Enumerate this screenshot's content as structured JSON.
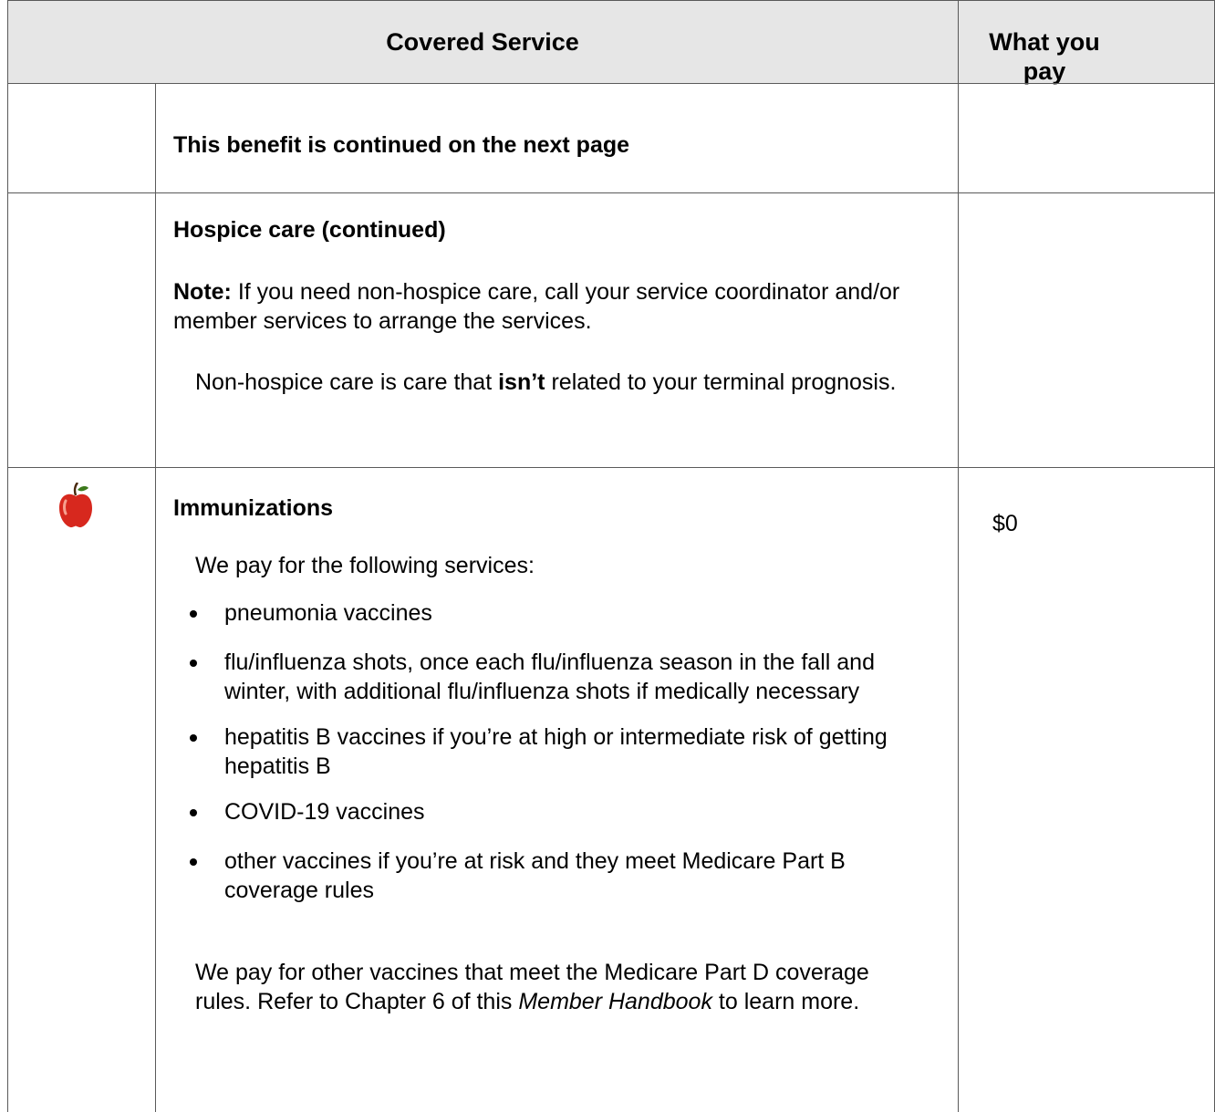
{
  "header": {
    "covered_service": "Covered Service",
    "what_you_pay": "What you pay"
  },
  "row_continued": {
    "text": "This benefit is continued on the next page"
  },
  "row_hospice": {
    "title": "Hospice care (continued)",
    "note_label": "Note:",
    "note_text": " If you need non-hospice care, call your service coordinator and/or member services to arrange the services.",
    "para_before": "Non-hospice care is care that ",
    "para_bold": "isn’t",
    "para_after": " related to your terminal prognosis."
  },
  "row_immunizations": {
    "icon": "apple-icon",
    "icon_color": "#d7281e",
    "title": "Immunizations",
    "pay": "$0",
    "intro": "We pay for the following services:",
    "bullets": [
      "pneumonia vaccines",
      "flu/influenza shots, once each flu/influenza season in the fall and winter, with additional flu/influenza shots if medically necessary",
      "hepatitis B vaccines if you’re at high or intermediate risk of getting hepatitis B",
      "COVID-19 vaccines",
      "other vaccines if you’re at risk and they meet Medicare Part B coverage rules"
    ],
    "closing_before": "We pay for other vaccines that meet the Medicare Part D coverage rules. Refer to Chapter 6 of this ",
    "closing_italic": "Member Handbook",
    "closing_after": " to learn more."
  },
  "colors": {
    "header_bg": "#e6e6e6",
    "rule": "#5a5a5a"
  }
}
